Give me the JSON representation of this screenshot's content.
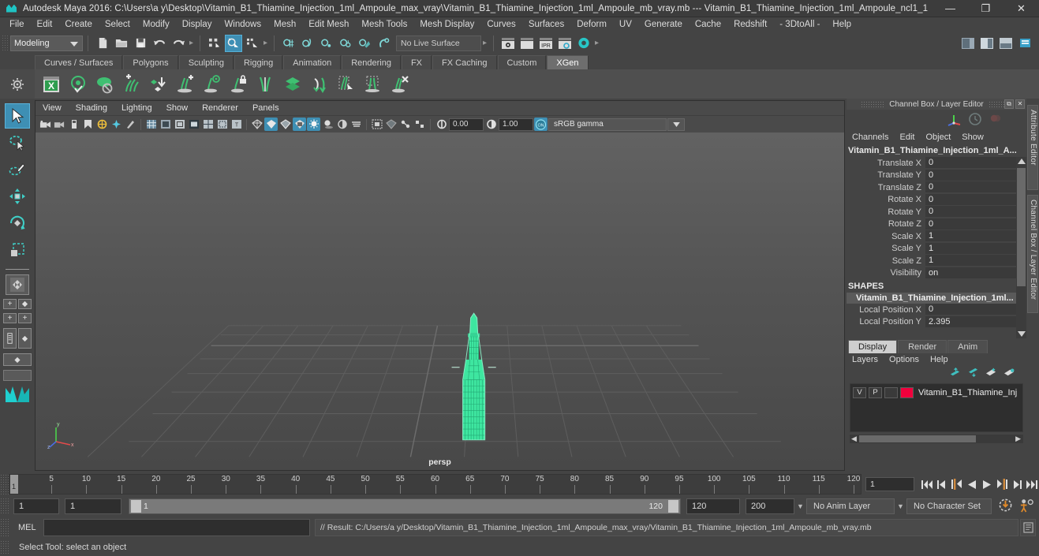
{
  "window": {
    "title": "Autodesk Maya 2016: C:\\Users\\a y\\Desktop\\Vitamin_B1_Thiamine_Injection_1ml_Ampoule_max_vray\\Vitamin_B1_Thiamine_Injection_1ml_Ampoule_mb_vray.mb  ---  Vitamin_B1_Thiamine_Injection_1ml_Ampoule_ncl1_1",
    "app_icon": "maya-logo-icon",
    "minimize": "—",
    "maximize": "❐",
    "close": "✕"
  },
  "menubar": {
    "items": [
      "File",
      "Edit",
      "Create",
      "Select",
      "Modify",
      "Display",
      "Windows",
      "Mesh",
      "Edit Mesh",
      "Mesh Tools",
      "Mesh Display",
      "Curves",
      "Surfaces",
      "Deform",
      "UV",
      "Generate",
      "Cache",
      "Redshift",
      "- 3DtoAll -",
      "Help"
    ]
  },
  "statusbar": {
    "mode": "Modeling",
    "live_surface": "No Live Surface",
    "icons": [
      "new-scene-icon",
      "open-scene-icon",
      "save-scene-icon",
      "undo-icon",
      "redo-icon",
      "select-by-hierarchy-icon",
      "select-by-object-icon",
      "select-by-component-icon",
      "snap-grid-icon",
      "snap-curve-icon",
      "snap-point-icon",
      "snap-projected-center-icon",
      "snap-view-plane-icon",
      "make-live-icon",
      "render-view-icon",
      "render-current-frame-icon",
      "ipr-render-icon",
      "render-settings-icon",
      "hypershade-icon"
    ],
    "right_icons": [
      "show-hide-editors-icon",
      "channel-box-toggle-icon",
      "layer-editor-toggle-icon",
      "attribute-editor-toggle-icon"
    ]
  },
  "shelf": {
    "tabs": [
      "Curves / Surfaces",
      "Polygons",
      "Sculpting",
      "Rigging",
      "Animation",
      "Rendering",
      "FX",
      "FX Caching",
      "Custom",
      "XGen"
    ],
    "active_tab": "XGen",
    "icons": [
      "xgen-editor-icon",
      "xgen-preview-icon",
      "xgen-hide-icon",
      "xgen-add-clumping-icon",
      "xgen-add-noise-icon",
      "xgen-add-density-icon",
      "xgen-preview-guide-icon",
      "xgen-lock-guide-icon",
      "xgen-part-guides-icon",
      "xgen-layers-icon",
      "xgen-groom-icon",
      "xgen-select-guides-icon",
      "xgen-region-icon",
      "xgen-delete-guide-icon"
    ]
  },
  "toolbox": {
    "tools": [
      "select-tool",
      "lasso-select-tool",
      "paint-select-tool",
      "move-tool",
      "rotate-tool",
      "scale-tool"
    ],
    "active_tool": "select-tool",
    "layouts": [
      "single-perspective-layout",
      "four-view-layout",
      "outliner-persp-layout",
      "persp-graph-layout"
    ]
  },
  "viewport": {
    "menus": [
      "View",
      "Shading",
      "Lighting",
      "Show",
      "Renderer",
      "Panels"
    ],
    "camera_label": "persp",
    "exposure": "0.00",
    "gamma": "1.00",
    "color_management": "sRGB gamma",
    "toolbar_icons": [
      "select-camera-icon",
      "lock-camera-icon",
      "camera-attributes-icon",
      "bookmark-icon",
      "image-plane-icon",
      "two-d-pan-zoom-icon",
      "grid-toggle-icon",
      "film-gate-icon",
      "resolution-gate-icon",
      "gate-mask-icon",
      "field-chart-icon",
      "safe-action-icon",
      "safe-title-icon",
      "wireframe-icon",
      "smooth-shade-all-icon",
      "shaded-wireframe-icon",
      "textured-icon",
      "use-all-lights-icon",
      "shadows-icon",
      "screen-space-ao-icon",
      "motion-blur-icon",
      "multisample-icon",
      "depth-of-field-icon",
      "isolate-select-icon",
      "xray-icon",
      "xray-joints-icon",
      "xray-active-components-icon",
      "exposure-icon",
      "gamma-icon",
      "color-management-toggle-icon"
    ]
  },
  "channelbox": {
    "panel_title": "Channel Box / Layer Editor",
    "menus": [
      "Channels",
      "Edit",
      "Object",
      "Show"
    ],
    "node_name": "Vitamin_B1_Thiamine_Injection_1ml_A...",
    "transform_attrs": [
      {
        "label": "Translate X",
        "value": "0"
      },
      {
        "label": "Translate Y",
        "value": "0"
      },
      {
        "label": "Translate Z",
        "value": "0"
      },
      {
        "label": "Rotate X",
        "value": "0"
      },
      {
        "label": "Rotate Y",
        "value": "0"
      },
      {
        "label": "Rotate Z",
        "value": "0"
      },
      {
        "label": "Scale X",
        "value": "1"
      },
      {
        "label": "Scale Y",
        "value": "1"
      },
      {
        "label": "Scale Z",
        "value": "1"
      },
      {
        "label": "Visibility",
        "value": "on"
      }
    ],
    "shapes_header": "SHAPES",
    "shape_name": "Vitamin_B1_Thiamine_Injection_1ml...",
    "shape_attrs": [
      {
        "label": "Local Position X",
        "value": "0"
      },
      {
        "label": "Local Position Y",
        "value": "2.395"
      }
    ],
    "gizmo_icons": [
      "axis-tripod-icon",
      "clock-icon",
      "rgb-channels-icon"
    ]
  },
  "layer_editor": {
    "tabs": [
      "Display",
      "Render",
      "Anim"
    ],
    "active_tab": "Display",
    "menus": [
      "Layers",
      "Options",
      "Help"
    ],
    "toolbar_icons": [
      "move-layer-up-icon",
      "move-layer-down-icon",
      "new-layer-icon",
      "new-layer-from-selected-icon"
    ],
    "layers": [
      {
        "visibility": "V",
        "playback": "P",
        "type": "",
        "color": "#f1003c",
        "name": "Vitamin_B1_Thiamine_Inj"
      }
    ]
  },
  "side_tabs": [
    "Attribute Editor",
    "Channel Box / Layer Editor"
  ],
  "timeline": {
    "ticks": [
      5,
      10,
      15,
      20,
      25,
      30,
      35,
      40,
      45,
      50,
      55,
      60,
      65,
      70,
      75,
      80,
      85,
      90,
      95,
      100,
      105,
      110,
      115,
      120
    ],
    "current_frame": "1",
    "current_frame_field": "1",
    "playback_buttons": [
      "go-to-start-icon",
      "step-back-keyframe-icon",
      "step-back-frame-icon",
      "play-backwards-icon",
      "play-forwards-icon",
      "step-forward-frame-icon",
      "step-forward-keyframe-icon",
      "go-to-end-icon"
    ]
  },
  "rangebar": {
    "anim_start": "1",
    "range_start": "1",
    "slider_min_label": "1",
    "slider_max_label": "120",
    "range_end": "120",
    "anim_end": "200",
    "anim_layer": "No Anim Layer",
    "character_set": "No Character Set",
    "auto_key_icon": "auto-keyframe-icon",
    "anim_prefs_icon": "animation-preferences-icon"
  },
  "commandline": {
    "language_label": "MEL",
    "input_value": "",
    "result_text": "// Result: C:/Users/a y/Desktop/Vitamin_B1_Thiamine_Injection_1ml_Ampoule_max_vray/Vitamin_B1_Thiamine_Injection_1ml_Ampoule_mb_vray.mb",
    "script_editor_icon": "script-editor-icon"
  },
  "helpline": {
    "text": "Select Tool: select an object"
  },
  "colors": {
    "accent_blue": "#3e8fb4",
    "mesh_green": "#3ee6a0",
    "layer_red": "#f1003c",
    "bg": "#444444"
  }
}
